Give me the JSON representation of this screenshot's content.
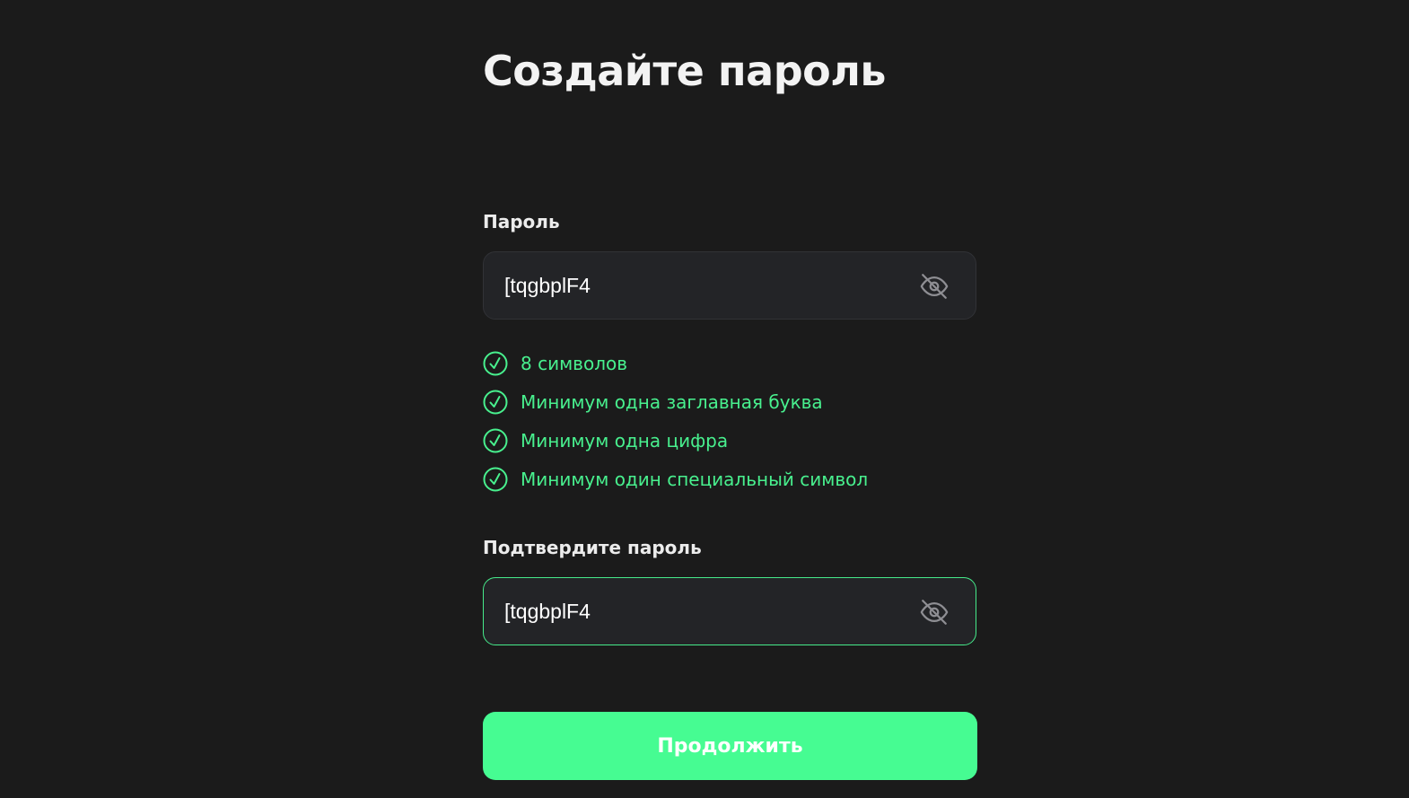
{
  "title": "Создайте пароль",
  "password": {
    "label": "Пароль",
    "value": "[tqgbplF4",
    "toggle_icon": "eye-off-icon"
  },
  "requirements": [
    {
      "text": "8 символов",
      "met": true
    },
    {
      "text": "Минимум одна заглавная буква",
      "met": true
    },
    {
      "text": "Минимум одна цифра",
      "met": true
    },
    {
      "text": "Минимум один специальный символ",
      "met": true
    }
  ],
  "confirm": {
    "label": "Подтвердите пароль",
    "value": "[tqgbplF4",
    "toggle_icon": "eye-off-icon"
  },
  "continue_label": "Продолжить",
  "colors": {
    "background": "#1b1b1b",
    "field_bg": "#232427",
    "accent": "#46fc92",
    "success_text": "#48f08e"
  }
}
